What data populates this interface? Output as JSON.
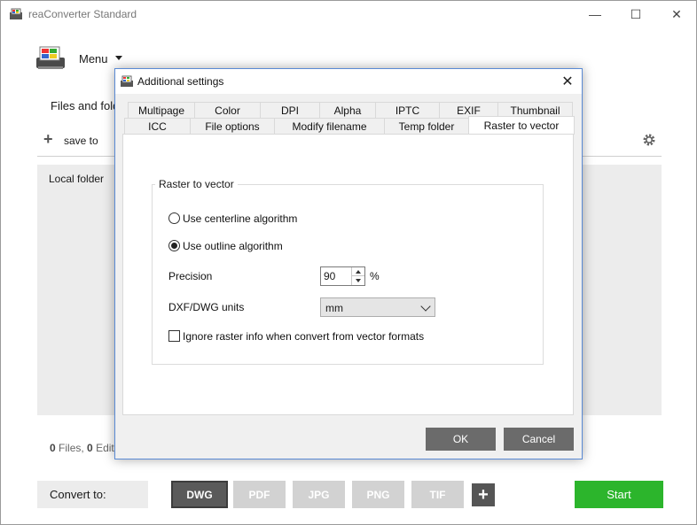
{
  "window": {
    "title": "reaConverter Standard",
    "minimize_glyph": "—",
    "maximize_glyph": "☐",
    "close_glyph": "✕"
  },
  "menu": {
    "label": "Menu"
  },
  "files": {
    "heading": "Files and folders",
    "save_to_label": "save to",
    "local_folder_label": "Local folder",
    "files_count": "0",
    "files_label": "Files,",
    "edits_count": "0",
    "edits_label": "Edits"
  },
  "convert": {
    "label": "Convert to:",
    "formats": [
      "DWG",
      "PDF",
      "JPG",
      "PNG",
      "TIF"
    ],
    "selected_format": "DWG",
    "start_label": "Start"
  },
  "dialog": {
    "title": "Additional settings",
    "tabs_row1": [
      "Multipage",
      "Color",
      "DPI",
      "Alpha",
      "IPTC",
      "EXIF",
      "Thumbnail"
    ],
    "tabs_row2": [
      "ICC",
      "File options",
      "Modify filename",
      "Temp folder",
      "Raster to vector"
    ],
    "active_tab": "Raster to vector",
    "group_title": "Raster to vector",
    "option_centerline": "Use centerline algorithm",
    "option_outline": "Use outline algorithm",
    "selected_algorithm": "outline",
    "precision_label": "Precision",
    "precision_value": "90",
    "precision_unit": "%",
    "units_label": "DXF/DWG units",
    "units_value": "mm",
    "ignore_raster_label": "Ignore raster info when convert from vector formats",
    "ignore_raster_checked": false,
    "ok_label": "OK",
    "cancel_label": "Cancel"
  },
  "colors": {
    "start_green": "#2cb52c",
    "dialog_button": "#6b6b6b",
    "active_format": "#5a5a5a",
    "inactive_format": "#d2d2d2"
  },
  "icons": {
    "app": "reaconverter-app-icon",
    "gear": "gear-icon",
    "plus": "plus-icon"
  }
}
